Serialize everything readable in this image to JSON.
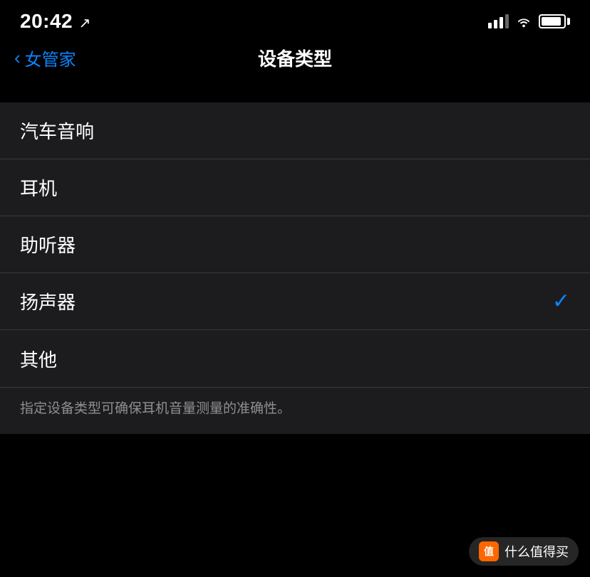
{
  "statusBar": {
    "time": "20:42",
    "locationIcon": "↗"
  },
  "navBar": {
    "backLabel": "女管家",
    "title": "设备类型"
  },
  "listItems": [
    {
      "id": "car-speaker",
      "label": "汽车音响",
      "selected": false
    },
    {
      "id": "headphones",
      "label": "耳机",
      "selected": false
    },
    {
      "id": "hearing-aid",
      "label": "助听器",
      "selected": false
    },
    {
      "id": "speaker",
      "label": "扬声器",
      "selected": true
    },
    {
      "id": "other",
      "label": "其他",
      "selected": false
    }
  ],
  "footer": {
    "note": "指定设备类型可确保耳机音量测量的准确性。"
  },
  "watermark": {
    "icon": "值",
    "text": "什么值得买"
  }
}
